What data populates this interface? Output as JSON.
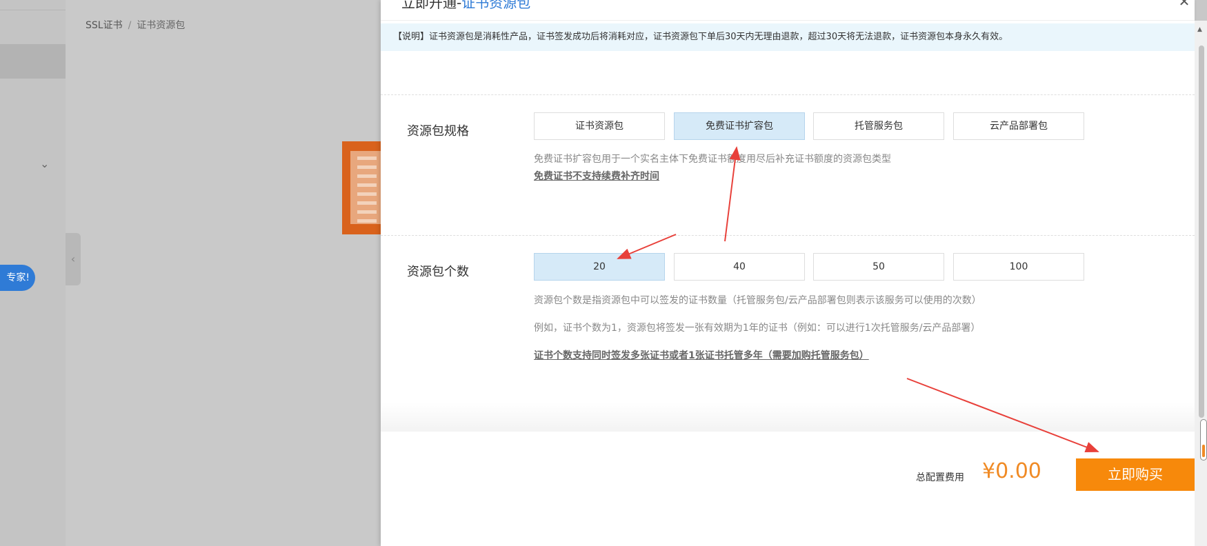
{
  "background": {
    "breadcrumb": {
      "root": "SSL证书",
      "separator": "/",
      "current": "证书资源包"
    },
    "promo_pill": "专家!"
  },
  "drawer": {
    "title": "立即开通",
    "title_highlight": "证书资源包",
    "notice": "【说明】证书资源包是消耗性产品，证书签发成功后将消耗对应，证书资源包下单后30天内无理由退款，超过30天将无法退款，证书资源包本身永久有效。",
    "spec": {
      "label": "资源包规格",
      "options": [
        "证书资源包",
        "免费证书扩容包",
        "托管服务包",
        "云产品部署包"
      ],
      "selected": "免费证书扩容包",
      "desc": "免费证书扩容包用于一个实名主体下免费证书额度用尽后补充证书额度的资源包类型",
      "note": "免费证书不支持续费补齐时间"
    },
    "count": {
      "label": "资源包个数",
      "options": [
        "20",
        "40",
        "50",
        "100"
      ],
      "selected": "20",
      "desc1": "资源包个数是指资源包中可以签发的证书数量（托管服务包/云产品部署包则表示该服务可以使用的次数）",
      "desc2": "例如，证书个数为1，资源包将签发一张有效期为1年的证书（例如：可以进行1次托管服务/云产品部署）",
      "note": "证书个数支持同时签发多张证书或者1张证书托管多年（需要加购托管服务包）"
    },
    "footer": {
      "total_label": "总配置费用",
      "total_price": "¥0.00",
      "buy_label": "立即购买"
    }
  },
  "colors": {
    "accent": "#2f7bd6",
    "price": "#f08a24",
    "buy_button": "#f7890b",
    "selected_option": "#d6eaf8",
    "annotation_arrow": "#e8403a"
  }
}
